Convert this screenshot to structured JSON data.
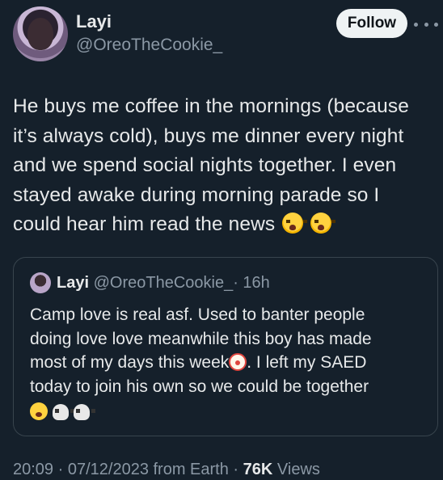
{
  "author": {
    "name": "Layi",
    "handle": "@OreoTheCookie_",
    "follow_label": "Follow"
  },
  "tweet": {
    "line1": "He buys me coffee in the mornings (because",
    "line2": "it’s always cold), buys me dinner every night",
    "line3": "and we spend social nights together. I even",
    "line4": "stayed awake during morning parade so I",
    "line5": "could hear him read the news",
    "emojis": [
      "loudly-crying-face",
      "loudly-crying-face"
    ]
  },
  "quote": {
    "name": "Layi",
    "handle": "@OreoTheCookie_",
    "time": "· 16h",
    "line1": "Camp love is real asf. Used to banter people",
    "line2": "doing love love meanwhile this boy has made",
    "line3a": "most of my days this week",
    "line3b": ". I left my SAED",
    "line4": "today to join his own so we could be together",
    "emojis": [
      "clown-face",
      "loudly-crying-face",
      "skull",
      "skull"
    ]
  },
  "meta": {
    "time": "20:09",
    "date": "· 07/12/2023 from Earth ·",
    "views_count": "76K",
    "views_label": "Views"
  }
}
